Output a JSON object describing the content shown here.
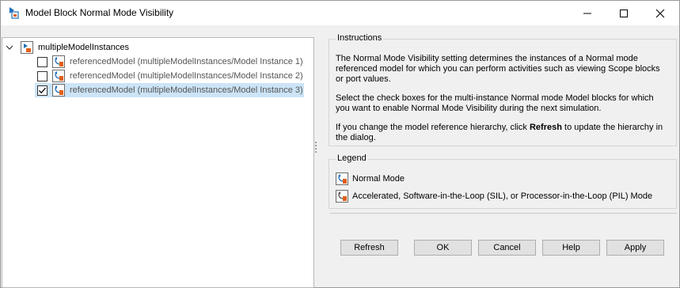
{
  "window": {
    "title": "Model Block Normal Mode Visibility",
    "controls": [
      "minimize-icon",
      "maximize-icon",
      "close-icon"
    ]
  },
  "tree": {
    "root": {
      "label": "multipleModelInstances",
      "expanded": true
    },
    "items": [
      {
        "label": "referencedModel (multipleModelInstances/Model Instance 1)",
        "checked": false,
        "selected": false
      },
      {
        "label": "referencedModel (multipleModelInstances/Model Instance 2)",
        "checked": false,
        "selected": false
      },
      {
        "label": "referencedModel (multipleModelInstances/Model Instance 3)",
        "checked": true,
        "selected": true
      }
    ]
  },
  "instructions": {
    "title": "Instructions",
    "p1": "The Normal Mode Visibility setting determines the instances of a Normal mode referenced model for which you can perform activities such as viewing Scope blocks or port values.",
    "p2": "Select the check boxes for the multi-instance Normal mode Model blocks for which you want to enable Normal Mode Visibility during the next simulation.",
    "p3_before": "If you change the model reference hierarchy, click ",
    "p3_bold": "Refresh",
    "p3_after": " to update the hierarchy in the dialog."
  },
  "legend": {
    "title": "Legend",
    "normal": "Normal Mode",
    "accelerated": "Accelerated, Software-in-the-Loop (SIL), or Processor-in-the-Loop (PIL) Mode"
  },
  "buttons": {
    "refresh": "Refresh",
    "ok": "OK",
    "cancel": "Cancel",
    "help": "Help",
    "apply": "Apply"
  },
  "colors": {
    "selection": "#cce4f7",
    "button_face": "#e1e1e1",
    "simulink_blue": "#1f6fb8",
    "simulink_orange": "#e0601a"
  }
}
